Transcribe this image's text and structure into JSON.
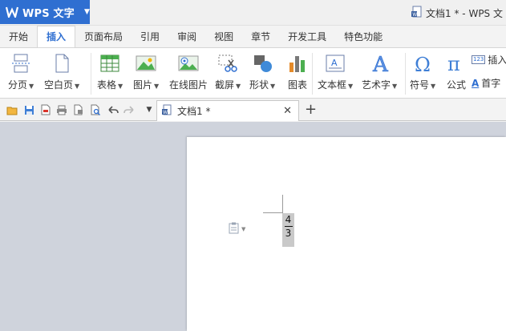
{
  "app": {
    "name": "WPS 文字",
    "brand_color": "#2f6fd1",
    "window_title": "文档1 * - WPS 文"
  },
  "ribbon_tabs": [
    "开始",
    "插入",
    "页面布局",
    "引用",
    "审阅",
    "视图",
    "章节",
    "开发工具",
    "特色功能"
  ],
  "active_tab": "插入",
  "ribbon": {
    "page_break": "分页",
    "blank_page": "空白页",
    "table": "表格",
    "picture": "图片",
    "online_picture": "在线图片",
    "screenshot": "截屏",
    "shapes": "形状",
    "chart": "图表",
    "textbox": "文本框",
    "wordart": "艺术字",
    "symbol": "符号",
    "formula": "公式",
    "insert_number": "插入",
    "dropcap": "首字",
    "number_icon_text": "123"
  },
  "document": {
    "tab_label": "文档1 *",
    "fraction": {
      "numerator": "4",
      "denominator": "3"
    }
  },
  "colors": {
    "workspace": "#cfd3dc",
    "selection": "#c9c9c9",
    "accent": "#2f6fd1"
  }
}
